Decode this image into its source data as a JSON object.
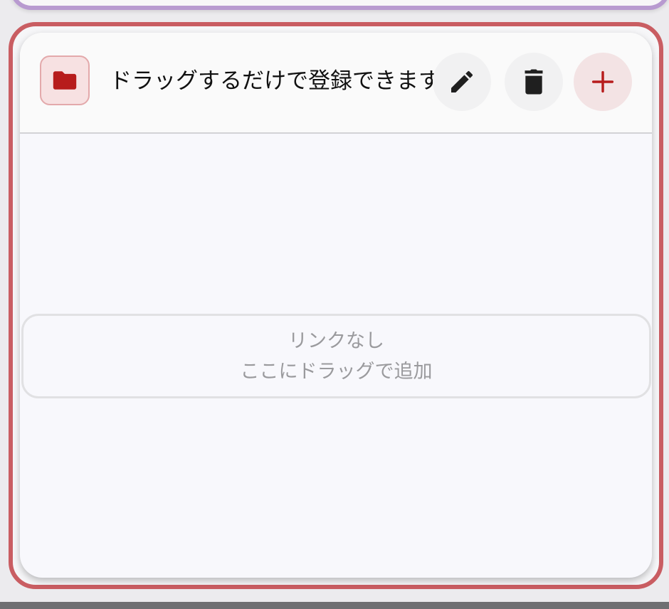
{
  "card": {
    "title": "ドラッグするだけで登録できます",
    "icons": {
      "folder": "folder-icon",
      "edit": "pencil-icon",
      "delete": "trash-icon",
      "add": "plus-icon"
    },
    "accent_color": "#b71c1c",
    "frame_color": "#c95d62"
  },
  "empty_state": {
    "line1": "リンクなし",
    "line2": "ここにドラッグで追加"
  }
}
